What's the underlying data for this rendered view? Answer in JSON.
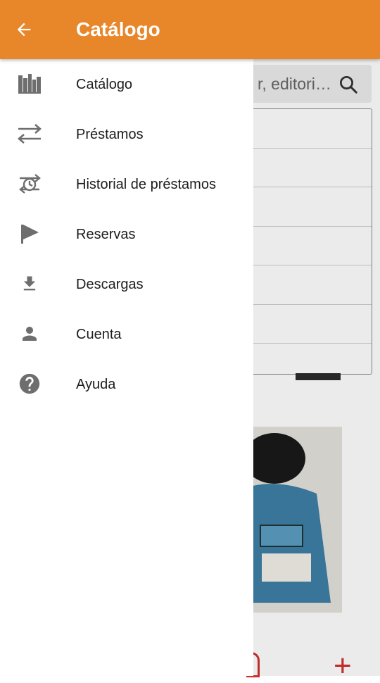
{
  "appbar": {
    "title": "Catálogo",
    "back_icon": "arrow-back-icon",
    "color": "#e8862a"
  },
  "drawer": {
    "items": [
      {
        "label": "Catálogo",
        "icon": "library-icon"
      },
      {
        "label": "Préstamos",
        "icon": "swap-arrows-icon"
      },
      {
        "label": "Historial de préstamos",
        "icon": "history-icon"
      },
      {
        "label": "Reservas",
        "icon": "flag-icon"
      },
      {
        "label": "Descargas",
        "icon": "download-icon"
      },
      {
        "label": "Cuenta",
        "icon": "person-icon"
      },
      {
        "label": "Ayuda",
        "icon": "help-icon"
      }
    ]
  },
  "background": {
    "search_placeholder": "r, editori…",
    "search_icon": "search-icon",
    "accent_red": "#d32f2f"
  }
}
